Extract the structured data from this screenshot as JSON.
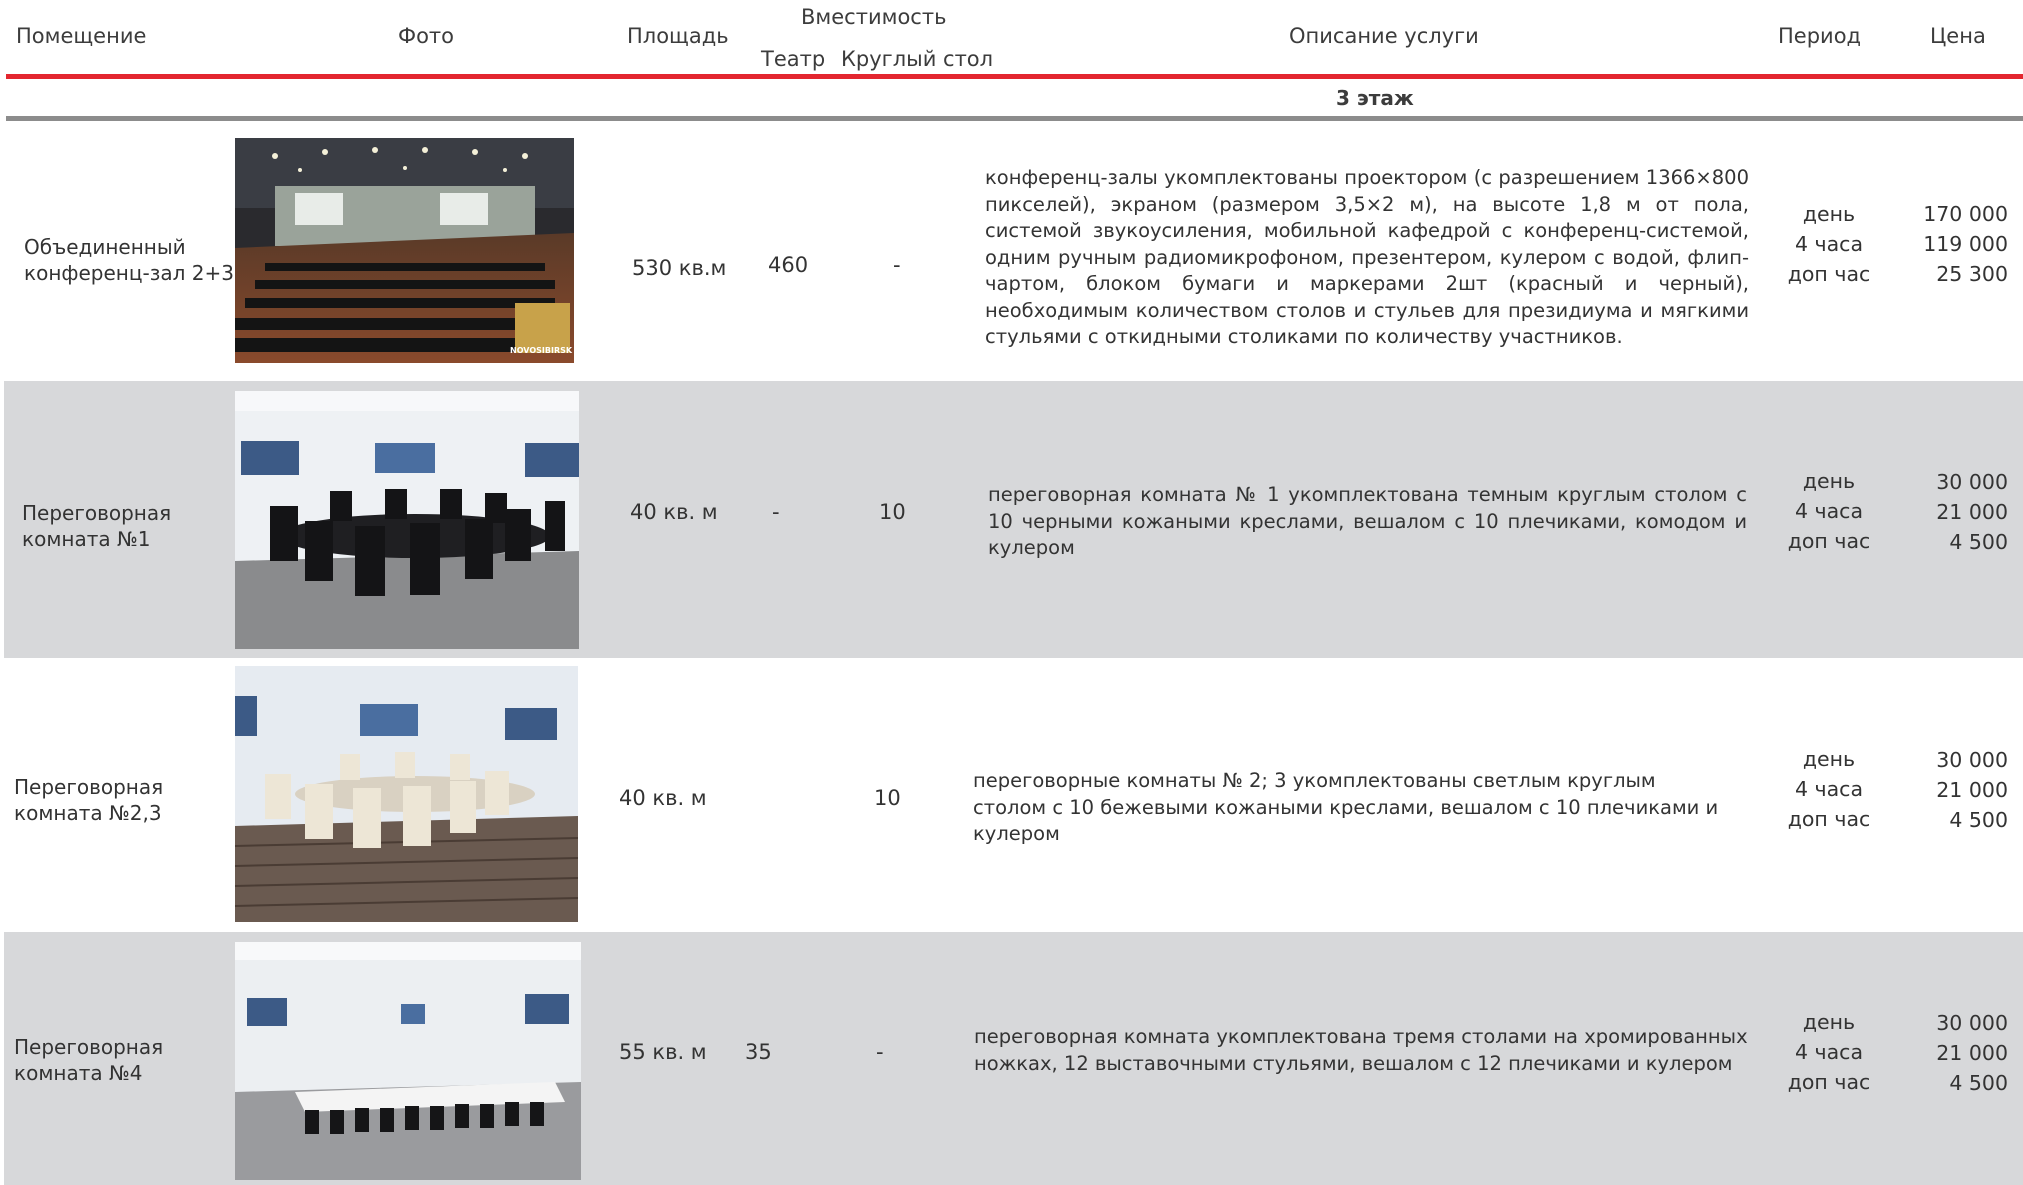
{
  "headers": {
    "room": "Помещение",
    "photo": "Фото",
    "area": "Площадь",
    "capacity": "Вместимость",
    "theatre": "Театр",
    "round_table": "Круглый стол",
    "description": "Описание услуги",
    "period": "Период",
    "price": "Цена"
  },
  "section": {
    "title": "3 этаж"
  },
  "rows": [
    {
      "room": [
        "Объединенный",
        "конференц-зал 2+3"
      ],
      "photo": "conference-hall-photo",
      "photo_watermark": "NOVOSIBIRSK",
      "area": "530 кв.м",
      "theatre": "460",
      "round_table": "-",
      "description": "конференц-залы укомплектованы проектором (с разрешением 1366×800 пикселей), экраном (размером 3,5×2 м), на высоте 1,8 м от пола, системой звукоусиления, мобильной кафедрой с конференц-системой, одним ручным радиомикрофоном, презентером, кулером с водой, флип-чартом, блоком бумаги и маркерами 2шт (красный и черный), необходимым количеством столов и стульев для президиума и мягкими стульями с откидными столиками по количеству участников.",
      "periods": [
        "день",
        "4 часа",
        "доп час"
      ],
      "prices": [
        "170 000",
        "119 000",
        "25 300"
      ]
    },
    {
      "room": [
        "Переговорная",
        "комната №1"
      ],
      "photo": "meeting-room-1-photo",
      "area": "40 кв. м",
      "theatre": "-",
      "round_table": "10",
      "description": "переговорная комната № 1 укомплектована темным круглым столом с 10 черными кожаными креслами, вешалом с 10 плечиками, комодом и кулером",
      "periods": [
        "день",
        "4 часа",
        "доп час"
      ],
      "prices": [
        "30 000",
        "21 000",
        "4 500"
      ]
    },
    {
      "room": [
        "Переговорная",
        "комната №2,3"
      ],
      "photo": "meeting-room-2-3-photo",
      "area": "40 кв. м",
      "theatre": "",
      "round_table": "10",
      "description": "переговорные комнаты № 2; 3 укомплектованы светлым круглым столом с 10 бежевыми кожаными креслами, вешалом с 10 плечиками и кулером",
      "periods": [
        "день",
        "4 часа",
        "доп час"
      ],
      "prices": [
        "30 000",
        "21 000",
        "4 500"
      ]
    },
    {
      "room": [
        "Переговорная",
        "комната №4"
      ],
      "photo": "meeting-room-4-photo",
      "area": "55 кв. м",
      "theatre": "35",
      "round_table": "-",
      "description": "переговорная комната укомплектована тремя столами на хромированных ножках, 12 выставочными стульями, вешалом с 12 плечиками  и кулером",
      "periods": [
        "день",
        "4 часа",
        "доп час"
      ],
      "prices": [
        "30 000",
        "21 000",
        "4 500"
      ]
    }
  ],
  "colors": {
    "header_rule": "#e3262f",
    "section_rule": "#8c8c8c",
    "row_band": "#d7d8da",
    "text": "#333333"
  }
}
